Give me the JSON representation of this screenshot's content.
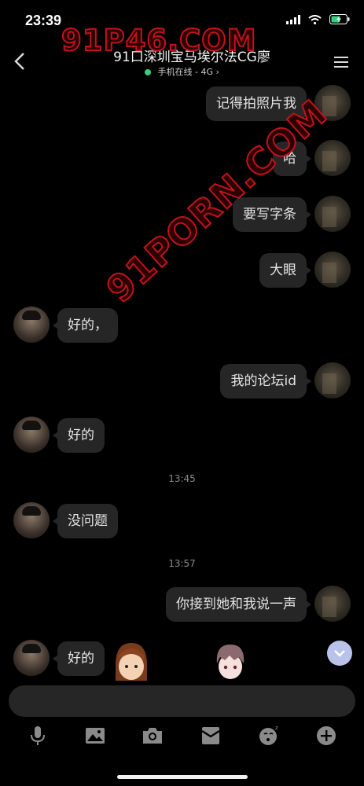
{
  "status_bar": {
    "time": "23:39"
  },
  "header": {
    "title": "91口深圳宝马埃尔法CG廖",
    "subtitle": "手机在线 - 4G"
  },
  "watermarks": [
    "91P46.COM",
    "91PORN.COM"
  ],
  "messages": [
    {
      "sender": "me",
      "text": "记得拍照片我"
    },
    {
      "sender": "me",
      "text": "哈"
    },
    {
      "sender": "me",
      "text": "要写字条"
    },
    {
      "sender": "me",
      "text": "大眼"
    },
    {
      "sender": "peer",
      "text": "好的，"
    },
    {
      "sender": "me",
      "text": "我的论坛id"
    },
    {
      "sender": "peer",
      "text": "好的"
    },
    {
      "type": "time",
      "text": "13:45"
    },
    {
      "sender": "peer",
      "text": "没问题"
    },
    {
      "type": "time",
      "text": "13:57"
    },
    {
      "sender": "me",
      "text": "你接到她和我说一声"
    },
    {
      "sender": "peer",
      "text": "好的"
    }
  ],
  "toolbar_icons": [
    "microphone-icon",
    "image-icon",
    "camera-icon",
    "red-packet-icon",
    "emoji-icon",
    "plus-icon"
  ],
  "colors": {
    "online": "#35d07f",
    "bubble": "#262626",
    "watermark": "#c5121b",
    "scroll_button": "#b9c2e8"
  }
}
